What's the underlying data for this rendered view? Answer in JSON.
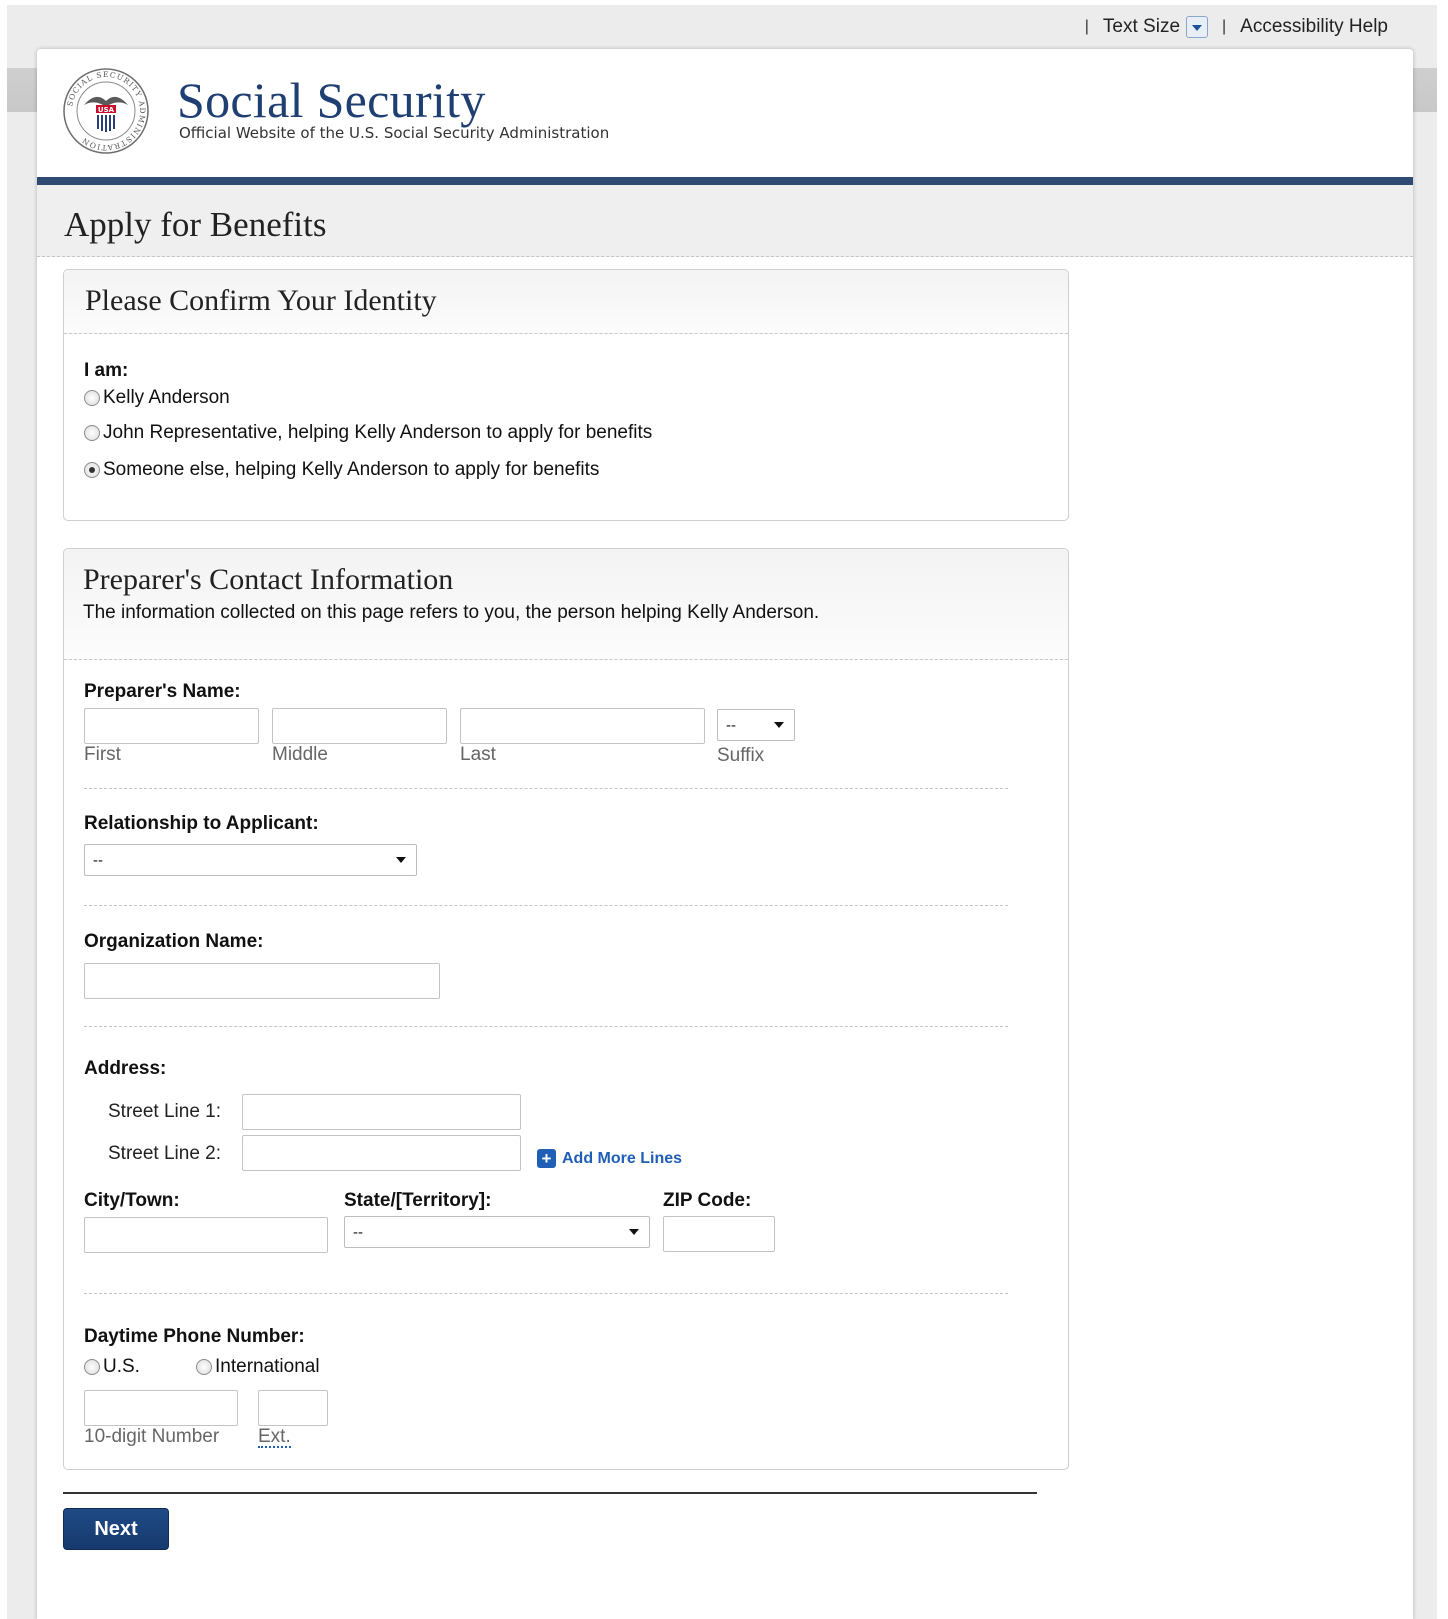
{
  "utility": {
    "separator": "|",
    "text_size_label": "Text Size",
    "accessibility_label": "Accessibility Help"
  },
  "header": {
    "brand_title": "Social Security",
    "brand_subtitle": "Official Website of the U.S. Social Security Administration",
    "seal_text": {
      "ring": "SOCIAL SECURITY ADMINISTRATION",
      "center": "USA"
    }
  },
  "page": {
    "title": "Apply for Benefits"
  },
  "identity": {
    "heading": "Please Confirm Your Identity",
    "i_am_label": "I am:",
    "options": [
      {
        "label": "Kelly Anderson",
        "selected": false
      },
      {
        "label": "John Representative, helping Kelly Anderson to apply for benefits",
        "selected": false
      },
      {
        "label": "Someone else, helping Kelly Anderson to apply for benefits",
        "selected": true
      }
    ]
  },
  "preparer": {
    "heading": "Preparer's Contact Information",
    "intro": "The information collected on this page refers to you, the person helping Kelly Anderson.",
    "name_label": "Preparer's Name:",
    "first_label": "First",
    "middle_label": "Middle",
    "last_label": "Last",
    "suffix_label": "Suffix",
    "suffix_value": "--",
    "relationship_label": "Relationship to Applicant:",
    "relationship_value": "--",
    "organization_label": "Organization Name:",
    "address_label": "Address:",
    "street1_label": "Street Line 1:",
    "street2_label": "Street Line 2:",
    "add_more_label": "Add More Lines",
    "city_label": "City/Town:",
    "state_label": "State/[Territory]:",
    "state_value": "--",
    "zip_label": "ZIP Code:",
    "phone_label": "Daytime Phone Number:",
    "phone_us_label": "U.S.",
    "phone_intl_label": "International",
    "phone_number_label": "10-digit Number",
    "phone_ext_label": "Ext."
  },
  "actions": {
    "next_label": "Next"
  },
  "colors": {
    "brand_navy": "#1f3f73",
    "rule_navy": "#2f4a73",
    "link_blue": "#1f5fb5",
    "button_navy": "#1f4a86"
  }
}
